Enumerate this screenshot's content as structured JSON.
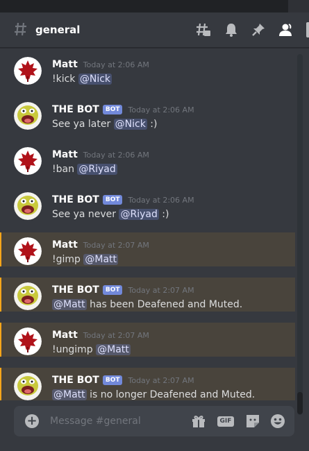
{
  "channel": {
    "name": "general"
  },
  "colors": {
    "background": "#36393f",
    "mention_highlight": "#49443c",
    "mention_bar": "#faa61a",
    "bot_tag": "#7289da",
    "text": "#dcddde",
    "muted": "#72767d"
  },
  "header_icons": [
    "threads-icon",
    "bell-icon",
    "pin-icon",
    "members-icon"
  ],
  "messages": [
    {
      "author": "Matt",
      "bot": false,
      "timestamp": "Today at 2:06 AM",
      "text": "!kick ",
      "mention": "@Nick",
      "suffix": "",
      "highlighted": false
    },
    {
      "author": "THE BOT",
      "bot": true,
      "bot_label": "BOT",
      "timestamp": "Today at 2:06 AM",
      "text": "See ya later ",
      "mention": "@Nick",
      "suffix": " :)",
      "highlighted": false
    },
    {
      "author": "Matt",
      "bot": false,
      "timestamp": "Today at 2:06 AM",
      "text": "!ban ",
      "mention": "@Riyad",
      "suffix": "",
      "highlighted": false
    },
    {
      "author": "THE BOT",
      "bot": true,
      "bot_label": "BOT",
      "timestamp": "Today at 2:06 AM",
      "text": "See ya never ",
      "mention": "@Riyad",
      "suffix": " :)",
      "highlighted": false
    },
    {
      "author": "Matt",
      "bot": false,
      "timestamp": "Today at 2:07 AM",
      "text": "!gimp ",
      "mention": "@Matt",
      "suffix": "",
      "highlighted": true
    },
    {
      "author": "THE BOT",
      "bot": true,
      "bot_label": "BOT",
      "timestamp": "Today at 2:07 AM",
      "text": "",
      "mention": "@Matt",
      "suffix": " has been Deafened and Muted.",
      "highlighted": true
    },
    {
      "author": "Matt",
      "bot": false,
      "timestamp": "Today at 2:07 AM",
      "text": "!ungimp ",
      "mention": "@Matt",
      "suffix": "",
      "highlighted": true
    },
    {
      "author": "THE BOT",
      "bot": true,
      "bot_label": "BOT",
      "timestamp": "Today at 2:07 AM",
      "text": "",
      "mention": "@Matt",
      "suffix": " is no longer Deafened and Muted.",
      "highlighted": true
    }
  ],
  "composer": {
    "placeholder": "Message #general",
    "gif_label": "GIF",
    "icons": [
      "gift-icon",
      "gif-icon",
      "sticker-icon",
      "emoji-icon"
    ]
  }
}
